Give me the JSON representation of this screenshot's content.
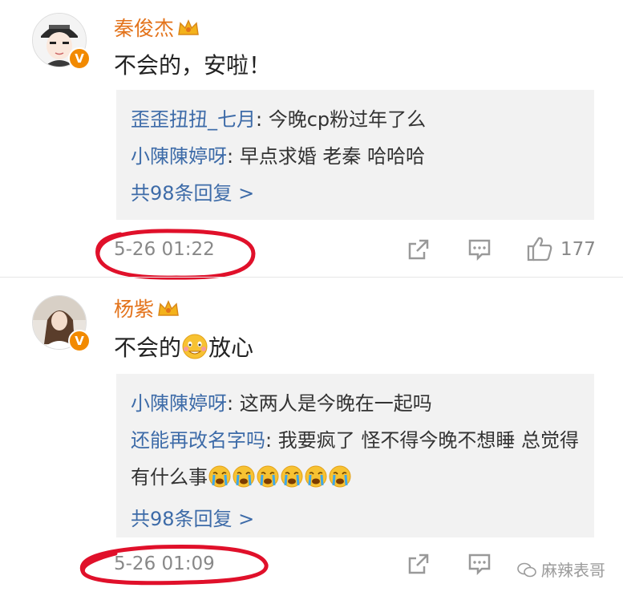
{
  "comments": [
    {
      "username": "秦俊杰",
      "text": "不会的，安啦！",
      "replies": [
        {
          "name": "歪歪扭扭_七月",
          "text": ": 今晚cp粉过年了么"
        },
        {
          "name": "小陳陳婷呀",
          "text": ": 早点求婚 老秦 哈哈哈"
        }
      ],
      "more": "共98条回复 >",
      "time": "5-26 01:22",
      "likes": "177"
    },
    {
      "username": "杨紫",
      "text_before": "不会的",
      "text_after": "放心",
      "replies": [
        {
          "name": "小陳陳婷呀",
          "text": ": 这两人是今晚在一起吗"
        },
        {
          "name": "还能再改名字吗",
          "text": ": 我要疯了  怪不得今晚不想睡  总觉得有什么事"
        }
      ],
      "more": "共98条回复 >",
      "time": "5-26 01:09"
    }
  ],
  "badge_letter": "V",
  "watermark": "麻辣表哥",
  "colors": {
    "username": "#e3731b",
    "reply_name": "#3d6ba8",
    "highlight_circle": "#e0102a",
    "badge": "#f28a00"
  },
  "icons": [
    "crown-icon",
    "share-icon",
    "comment-icon",
    "like-icon",
    "crying-emoji",
    "nervous-emoji"
  ]
}
